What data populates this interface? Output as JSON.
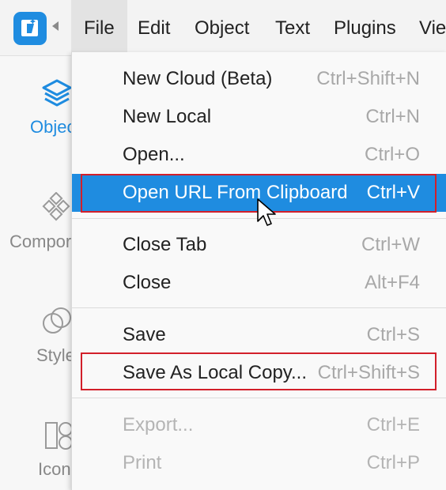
{
  "menubar": {
    "menus": [
      {
        "label": "File"
      },
      {
        "label": "Edit"
      },
      {
        "label": "Object"
      },
      {
        "label": "Text"
      },
      {
        "label": "Plugins"
      },
      {
        "label": "Vie"
      }
    ]
  },
  "left_panel": {
    "items": [
      {
        "label": "Objec",
        "icon": "layers-icon"
      },
      {
        "label": "Compor",
        "icon": "components-icon"
      },
      {
        "label": "Style",
        "icon": "styles-icon"
      },
      {
        "label": "Icon",
        "icon": "icons-icon"
      }
    ]
  },
  "file_menu": {
    "items": [
      {
        "label": "New Cloud (Beta)",
        "shortcut": "Ctrl+Shift+N"
      },
      {
        "label": "New Local",
        "shortcut": "Ctrl+N"
      },
      {
        "label": "Open...",
        "shortcut": "Ctrl+O"
      },
      {
        "label": "Open URL From Clipboard",
        "shortcut": "Ctrl+V"
      },
      {
        "label": "Close Tab",
        "shortcut": "Ctrl+W"
      },
      {
        "label": "Close",
        "shortcut": "Alt+F4"
      },
      {
        "label": "Save",
        "shortcut": "Ctrl+S"
      },
      {
        "label": "Save As Local Copy...",
        "shortcut": "Ctrl+Shift+S"
      },
      {
        "label": "Export...",
        "shortcut": "Ctrl+E"
      },
      {
        "label": "Print",
        "shortcut": "Ctrl+P"
      }
    ]
  },
  "colors": {
    "accent": "#1f8ce0",
    "annotation_box": "#d21f2a",
    "disabled_text": "#b4b4b4",
    "shortcut_text": "#a8a8a8"
  }
}
